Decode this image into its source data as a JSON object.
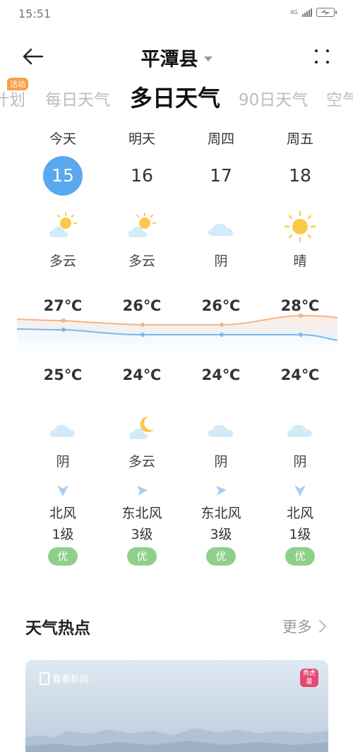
{
  "status_bar": {
    "time": "15:51",
    "network": "4G"
  },
  "header": {
    "city": "平潭县"
  },
  "tabs": [
    {
      "label": "计划"
    },
    {
      "label": "每日天气"
    },
    {
      "label": "多日天气"
    },
    {
      "label": "90日天气"
    },
    {
      "label": "空气"
    }
  ],
  "tab_badge": "活动",
  "forecast": [
    {
      "day": "今天",
      "date": "15",
      "day_condition": "多云",
      "day_icon": "partly-cloudy-sun-icon",
      "high": "27℃",
      "low": "25℃",
      "night_condition": "阴",
      "night_icon": "cloud-icon",
      "wind_dir": "北风",
      "wind_level": "1级",
      "aqi": "优"
    },
    {
      "day": "明天",
      "date": "16",
      "day_condition": "多云",
      "day_icon": "partly-cloudy-sun-icon",
      "high": "26℃",
      "low": "24℃",
      "night_condition": "多云",
      "night_icon": "partly-cloudy-moon-icon",
      "wind_dir": "东北风",
      "wind_level": "3级",
      "aqi": "优"
    },
    {
      "day": "周四",
      "date": "17",
      "day_condition": "阴",
      "day_icon": "cloud-icon",
      "high": "26℃",
      "low": "24℃",
      "night_condition": "阴",
      "night_icon": "cloud-icon",
      "wind_dir": "东北风",
      "wind_level": "3级",
      "aqi": "优"
    },
    {
      "day": "周五",
      "date": "18",
      "day_condition": "晴",
      "day_icon": "sun-icon",
      "high": "28℃",
      "low": "24℃",
      "night_condition": "阴",
      "night_icon": "cloud-icon",
      "wind_dir": "北风",
      "wind_level": "1级",
      "aqi": "优"
    }
  ],
  "colors": {
    "accent": "#5aa8ee",
    "high_line": "#f4b48a",
    "low_line": "#7db7e8",
    "aqi_good": "#8ed08b"
  },
  "news": {
    "title": "天气热点",
    "more": "更多",
    "source_logo": "看看新闻",
    "badge": "秀虎暑"
  }
}
